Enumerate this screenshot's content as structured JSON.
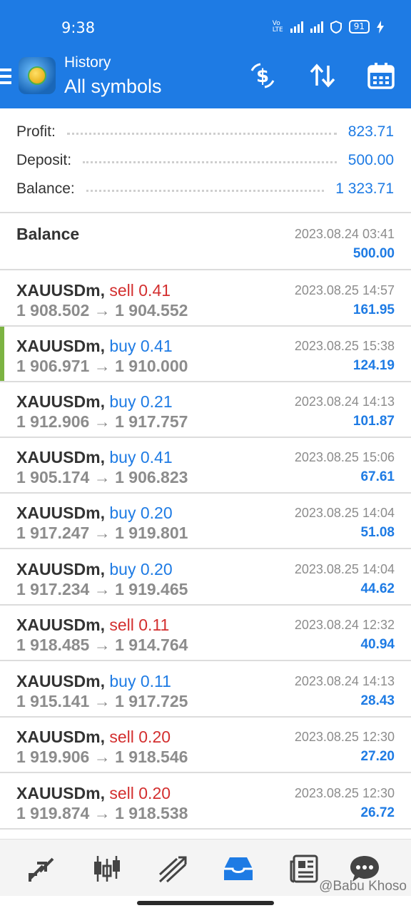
{
  "status_bar": {
    "time": "9:38",
    "battery": "91",
    "network_icons": [
      "volte-icon",
      "4g-signal-icon",
      "signal-icon",
      "vpn-shield-icon",
      "battery-icon",
      "charging-icon"
    ]
  },
  "header": {
    "title": "History",
    "subtitle": "All symbols",
    "actions": [
      "currency-exchange-icon",
      "sort-icon",
      "calendar-icon"
    ]
  },
  "summary": [
    {
      "label": "Profit:",
      "value": "823.71"
    },
    {
      "label": "Deposit:",
      "value": "500.00"
    },
    {
      "label": "Balance:",
      "value": "1 323.71"
    }
  ],
  "balance_entry": {
    "title": "Balance",
    "date": "2023.08.24 03:41",
    "amount": "500.00"
  },
  "deals": [
    {
      "symbol": "XAUUSDm,",
      "side": "sell",
      "volume": "0.41",
      "open": "1 908.502",
      "close": "1 904.552",
      "date": "2023.08.25 14:57",
      "profit": "161.95",
      "arrow": "→"
    },
    {
      "symbol": "XAUUSDm,",
      "side": "buy",
      "volume": "0.41",
      "open": "1 906.971",
      "close": "1 910.000",
      "date": "2023.08.25 15:38",
      "profit": "124.19",
      "arrow": "→"
    },
    {
      "symbol": "XAUUSDm,",
      "side": "buy",
      "volume": "0.21",
      "open": "1 912.906",
      "close": "1 917.757",
      "date": "2023.08.24 14:13",
      "profit": "101.87",
      "arrow": "→"
    },
    {
      "symbol": "XAUUSDm,",
      "side": "buy",
      "volume": "0.41",
      "open": "1 905.174",
      "close": "1 906.823",
      "date": "2023.08.25 15:06",
      "profit": "67.61",
      "arrow": "→"
    },
    {
      "symbol": "XAUUSDm,",
      "side": "buy",
      "volume": "0.20",
      "open": "1 917.247",
      "close": "1 919.801",
      "date": "2023.08.25 14:04",
      "profit": "51.08",
      "arrow": "→"
    },
    {
      "symbol": "XAUUSDm,",
      "side": "buy",
      "volume": "0.20",
      "open": "1 917.234",
      "close": "1 919.465",
      "date": "2023.08.25 14:04",
      "profit": "44.62",
      "arrow": "→"
    },
    {
      "symbol": "XAUUSDm,",
      "side": "sell",
      "volume": "0.11",
      "open": "1 918.485",
      "close": "1 914.764",
      "date": "2023.08.24 12:32",
      "profit": "40.94",
      "arrow": "→"
    },
    {
      "symbol": "XAUUSDm,",
      "side": "buy",
      "volume": "0.11",
      "open": "1 915.141",
      "close": "1 917.725",
      "date": "2023.08.24 14:13",
      "profit": "28.43",
      "arrow": "→"
    },
    {
      "symbol": "XAUUSDm,",
      "side": "sell",
      "volume": "0.20",
      "open": "1 919.906",
      "close": "1 918.546",
      "date": "2023.08.25 12:30",
      "profit": "27.20",
      "arrow": "→"
    },
    {
      "symbol": "XAUUSDm,",
      "side": "sell",
      "volume": "0.20",
      "open": "1 919.874",
      "close": "1 918.538",
      "date": "2023.08.25 12:30",
      "profit": "26.72",
      "arrow": "→"
    }
  ],
  "bottom_nav": [
    "quotes-arrows-icon",
    "chart-candles-icon",
    "trade-icon",
    "history-inbox-icon",
    "news-icon",
    "messages-icon"
  ],
  "watermark": "@Babu Khoso",
  "colors": {
    "accent": "#1e7be4",
    "sell": "#d32f2f",
    "muted": "#8c8c8c",
    "selected_bar": "#7cb342"
  }
}
